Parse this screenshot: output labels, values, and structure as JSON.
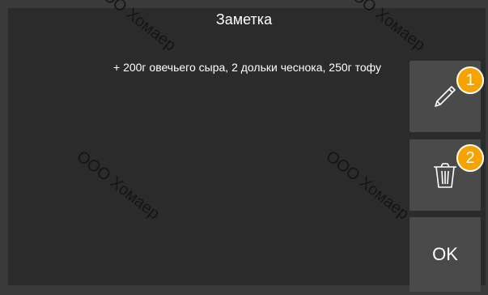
{
  "header": {
    "title": "Заметка"
  },
  "note": {
    "text": "+ 200г овечьего сыра, 2 дольки чеснока, 250г тофу"
  },
  "buttons": {
    "edit_icon": "pencil-icon",
    "delete_icon": "trash-icon",
    "ok_label": "OK"
  },
  "badges": [
    "1",
    "2"
  ],
  "watermark": {
    "top_left": "ООО Хомаер",
    "top_right": "ООО Хомаер",
    "bottom_left": "ООО Хомаер",
    "bottom_right": "ООО Хомаер"
  },
  "colors": {
    "background": "#2b2b2b",
    "button": "#4a4a4a",
    "badge": "#f5a300",
    "text": "#ffffff"
  }
}
